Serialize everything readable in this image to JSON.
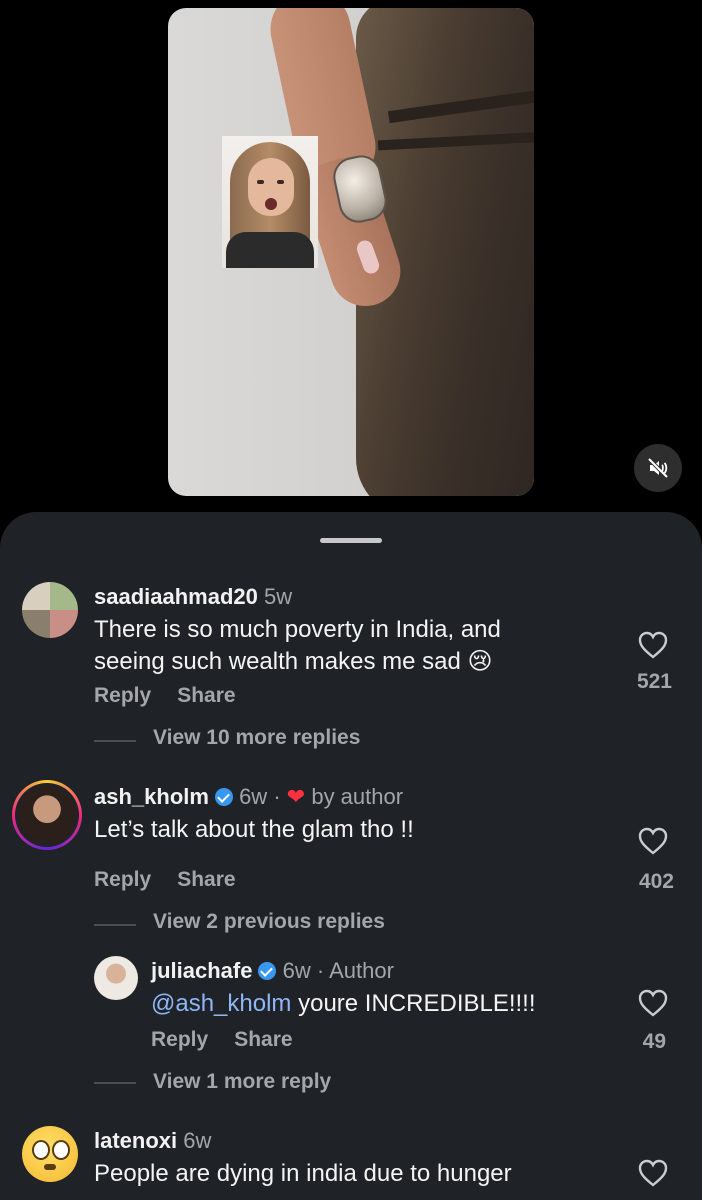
{
  "video": {
    "mute_icon": "muted-speaker-icon"
  },
  "comments": [
    {
      "username": "saadiaahmad20",
      "time": "5w",
      "text_line1": "There is so much poverty in India, and",
      "text_line2": "seeing such wealth makes me sad 😢",
      "reply_label": "Reply",
      "share_label": "Share",
      "likes": "521",
      "view_replies": "View 10 more replies"
    },
    {
      "username": "ash_kholm",
      "verified": true,
      "time": "6w",
      "separator": "·",
      "liked_by_author": "by author",
      "text": "Let’s talk about the glam tho !!",
      "reply_label": "Reply",
      "share_label": "Share",
      "likes": "402",
      "view_replies": "View 2 previous replies"
    },
    {
      "username": "juliachafe",
      "verified": true,
      "time": "6w",
      "separator": "·",
      "author_tag": "Author",
      "mention": "@ash_kholm",
      "text": " youre INCREDIBLE!!!!",
      "reply_label": "Reply",
      "share_label": "Share",
      "likes": "49",
      "view_replies": "View 1 more reply"
    },
    {
      "username": "latenoxi",
      "time": "6w",
      "text": "People are dying in india due to hunger"
    }
  ],
  "colors": {
    "sheet_bg": "#1f2226",
    "heart_red": "#ff3040",
    "mention_blue": "#8fb6f7",
    "verified_blue": "#3897f0"
  }
}
